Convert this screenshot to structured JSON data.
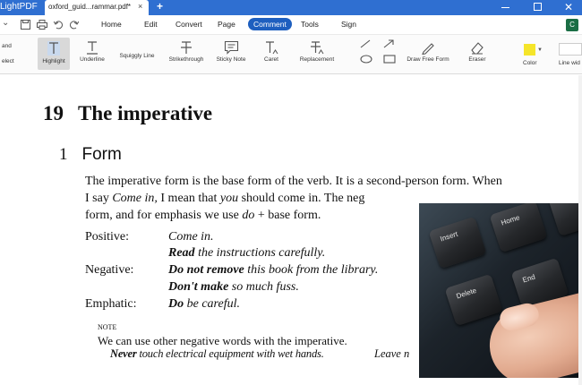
{
  "titlebar": {
    "app_name": "LightPDF",
    "doc_tab_label": "oxford_guid...rammar.pdf*",
    "tab_close": "×",
    "new_tab": "+"
  },
  "menubar": {
    "quick_chevron": "⌄",
    "items": [
      {
        "label": "Home"
      },
      {
        "label": "Edit"
      },
      {
        "label": "Convert"
      },
      {
        "label": "Page"
      },
      {
        "label": "Comment",
        "active": true
      },
      {
        "label": "Tools"
      },
      {
        "label": "Sign"
      }
    ],
    "avatar_initial": "C"
  },
  "ribbon": {
    "cut_labels": [
      "and",
      "elect"
    ],
    "tools": {
      "highlight": "Highlight",
      "underline": "Underline",
      "squiggly": "Squiggly Line",
      "strikethrough": "Strikethrough",
      "sticky_note": "Sticky Note",
      "caret": "Caret",
      "replacement": "Replacement",
      "draw_free_form": "Draw Free Form",
      "eraser": "Eraser",
      "color": "Color",
      "line_width": "Line wid"
    },
    "color_value": "#f5e52a"
  },
  "document": {
    "chapter_number": "19",
    "chapter_title": "The imperative",
    "section_number": "1",
    "section_title": "Form",
    "intro_line1": "The imperative form is the base form of the verb. It is a second-person form. When",
    "intro_line2a": "I say ",
    "intro_line2b": "Come in,",
    "intro_line2c": " I mean that ",
    "intro_line2d": "you",
    "intro_line2e": " should come in. The neg",
    "intro_line3a": "form, and for emphasis we use ",
    "intro_line3b": "do",
    "intro_line3c": " + base form.",
    "positive_label": "Positive:",
    "positive_ex1": "Come in.",
    "positive_ex2_bold": "Read",
    "positive_ex2_rest": " the instructions carefully.",
    "negative_label": "Negative:",
    "negative_ex1_bold": "Do not remove",
    "negative_ex1_rest": " this book from the library.",
    "negative_ex2_bold": "Don't make",
    "negative_ex2_rest": " so  much fuss.",
    "emphatic_label": "Emphatic:",
    "emphatic_ex_bold": "Do",
    "emphatic_ex_rest": " be careful.",
    "note_label": "NOTE",
    "note_text": "We can use other negative words with the imperative.",
    "note_ex_bold": "Never",
    "note_ex_rest": " touch electrical equipment with wet hands.",
    "note_ex2": "Leave n"
  },
  "photo": {
    "keys": [
      "Insert",
      "Home",
      "Delete",
      "End"
    ]
  }
}
